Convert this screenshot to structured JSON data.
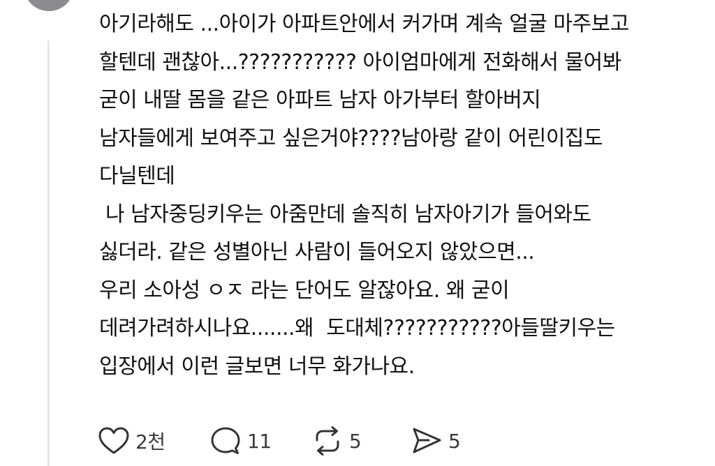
{
  "post": {
    "lines": [
      "아기라해도 ...아이가 아파트안에서 커가며 계속 얼굴 마주보고",
      "할텐데 괜찮아...??????????? 아이엄마에게 전화해서 물어봐",
      "굳이 내딸 몸을 같은 아파트 남자 아가부터 할아버지",
      "남자들에게 보여주고 싶은거야????남아랑 같이 어린이집도",
      "다닐텐데",
      " 나 남자중딩키우는 아줌만데 솔직히 남자아기가 들어와도",
      "싫더라. 같은 성별아닌 사람이 들어오지 않았으면...",
      "우리 소아성 ㅇㅈ 라는 단어도 알잖아요. 왜 굳이",
      "데려가려하시나요.......왜  도대체???????????아들딸키우는",
      "입장에서 이런 글보면 너무 화가나요."
    ]
  },
  "actions": {
    "like": {
      "icon": "heart-icon",
      "count": "2천"
    },
    "reply": {
      "icon": "comment-bubble-icon",
      "count": "11"
    },
    "repost": {
      "icon": "repost-icon",
      "count": "5"
    },
    "share": {
      "icon": "send-icon",
      "count": "5"
    }
  },
  "colors": {
    "avatar": "#8b8b90",
    "text": "#111111",
    "icon": "#333333",
    "thread_line": "#e6e6e6"
  }
}
